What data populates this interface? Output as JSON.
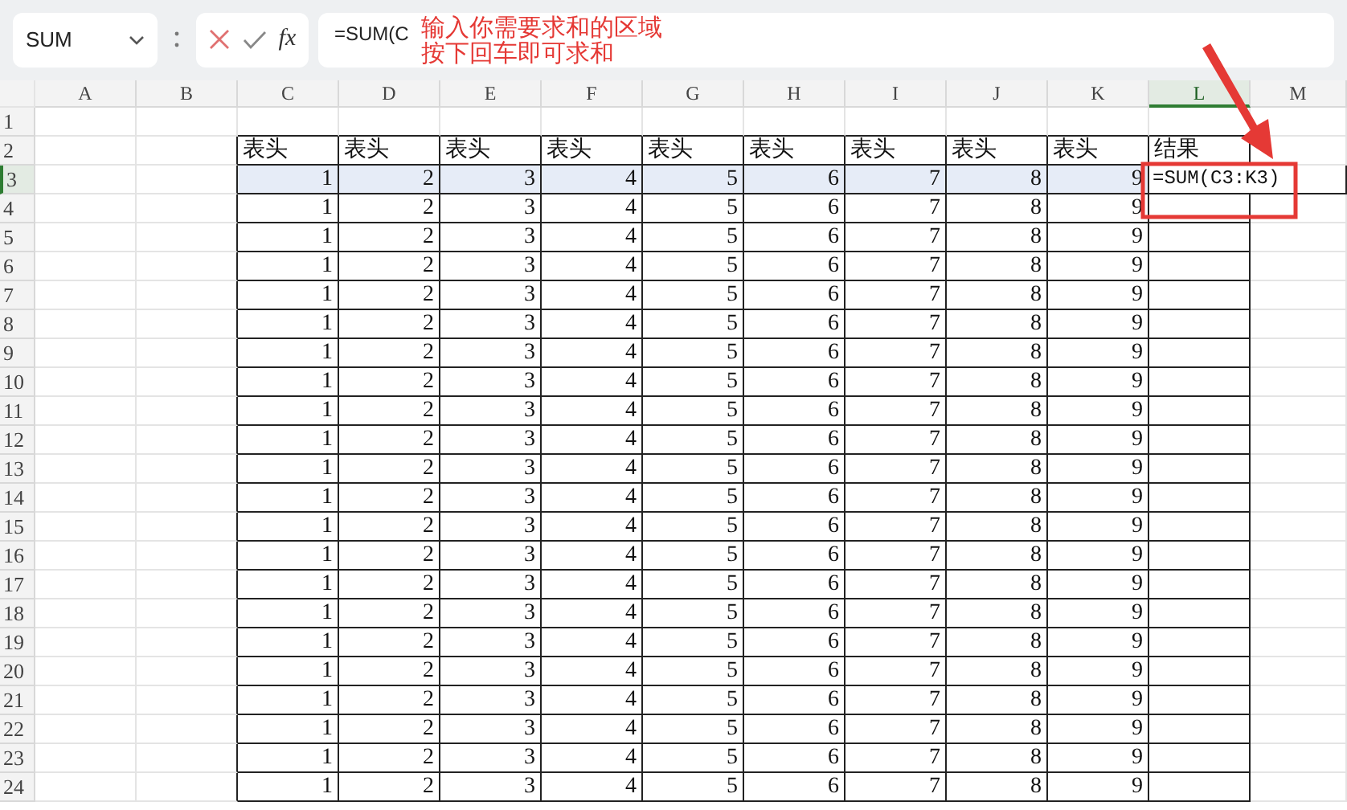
{
  "name_box": {
    "value": "SUM"
  },
  "formula_bar": {
    "function_label": "fx",
    "value": "=SUM(C"
  },
  "sheet": {
    "columns": [
      {
        "label": "A",
        "selected": false
      },
      {
        "label": "B",
        "selected": false
      },
      {
        "label": "C",
        "selected": false
      },
      {
        "label": "D",
        "selected": false
      },
      {
        "label": "E",
        "selected": false
      },
      {
        "label": "F",
        "selected": false
      },
      {
        "label": "G",
        "selected": false
      },
      {
        "label": "H",
        "selected": false
      },
      {
        "label": "I",
        "selected": false
      },
      {
        "label": "J",
        "selected": false
      },
      {
        "label": "K",
        "selected": false
      },
      {
        "label": "L",
        "selected": true
      },
      {
        "label": "M",
        "selected": false
      }
    ],
    "rows": [
      {
        "number": "1",
        "selected": false
      },
      {
        "number": "2",
        "selected": false,
        "cells": [
          "表头",
          "表头",
          "表头",
          "表头",
          "表头",
          "表头",
          "表头",
          "表头",
          "表头",
          "结果"
        ]
      },
      {
        "number": "3",
        "selected": true,
        "cells": [
          "1",
          "2",
          "3",
          "4",
          "5",
          "6",
          "7",
          "8",
          "9"
        ],
        "formula": "=SUM(C3:K3)"
      },
      {
        "number": "4",
        "selected": false,
        "cells": [
          "1",
          "2",
          "3",
          "4",
          "5",
          "6",
          "7",
          "8",
          "9"
        ]
      },
      {
        "number": "5",
        "selected": false,
        "cells": [
          "1",
          "2",
          "3",
          "4",
          "5",
          "6",
          "7",
          "8",
          "9"
        ]
      },
      {
        "number": "6",
        "selected": false,
        "cells": [
          "1",
          "2",
          "3",
          "4",
          "5",
          "6",
          "7",
          "8",
          "9"
        ]
      },
      {
        "number": "7",
        "selected": false,
        "cells": [
          "1",
          "2",
          "3",
          "4",
          "5",
          "6",
          "7",
          "8",
          "9"
        ]
      },
      {
        "number": "8",
        "selected": false,
        "cells": [
          "1",
          "2",
          "3",
          "4",
          "5",
          "6",
          "7",
          "8",
          "9"
        ]
      },
      {
        "number": "9",
        "selected": false,
        "cells": [
          "1",
          "2",
          "3",
          "4",
          "5",
          "6",
          "7",
          "8",
          "9"
        ]
      },
      {
        "number": "10",
        "selected": false,
        "cells": [
          "1",
          "2",
          "3",
          "4",
          "5",
          "6",
          "7",
          "8",
          "9"
        ]
      },
      {
        "number": "11",
        "selected": false,
        "cells": [
          "1",
          "2",
          "3",
          "4",
          "5",
          "6",
          "7",
          "8",
          "9"
        ]
      },
      {
        "number": "12",
        "selected": false,
        "cells": [
          "1",
          "2",
          "3",
          "4",
          "5",
          "6",
          "7",
          "8",
          "9"
        ]
      },
      {
        "number": "13",
        "selected": false,
        "cells": [
          "1",
          "2",
          "3",
          "4",
          "5",
          "6",
          "7",
          "8",
          "9"
        ]
      },
      {
        "number": "14",
        "selected": false,
        "cells": [
          "1",
          "2",
          "3",
          "4",
          "5",
          "6",
          "7",
          "8",
          "9"
        ]
      },
      {
        "number": "15",
        "selected": false,
        "cells": [
          "1",
          "2",
          "3",
          "4",
          "5",
          "6",
          "7",
          "8",
          "9"
        ]
      },
      {
        "number": "16",
        "selected": false,
        "cells": [
          "1",
          "2",
          "3",
          "4",
          "5",
          "6",
          "7",
          "8",
          "9"
        ]
      },
      {
        "number": "17",
        "selected": false,
        "cells": [
          "1",
          "2",
          "3",
          "4",
          "5",
          "6",
          "7",
          "8",
          "9"
        ]
      },
      {
        "number": "18",
        "selected": false,
        "cells": [
          "1",
          "2",
          "3",
          "4",
          "5",
          "6",
          "7",
          "8",
          "9"
        ]
      },
      {
        "number": "19",
        "selected": false,
        "cells": [
          "1",
          "2",
          "3",
          "4",
          "5",
          "6",
          "7",
          "8",
          "9"
        ]
      },
      {
        "number": "20",
        "selected": false,
        "cells": [
          "1",
          "2",
          "3",
          "4",
          "5",
          "6",
          "7",
          "8",
          "9"
        ]
      },
      {
        "number": "21",
        "selected": false,
        "cells": [
          "1",
          "2",
          "3",
          "4",
          "5",
          "6",
          "7",
          "8",
          "9"
        ]
      },
      {
        "number": "22",
        "selected": false,
        "cells": [
          "1",
          "2",
          "3",
          "4",
          "5",
          "6",
          "7",
          "8",
          "9"
        ]
      },
      {
        "number": "23",
        "selected": false,
        "cells": [
          "1",
          "2",
          "3",
          "4",
          "5",
          "6",
          "7",
          "8",
          "9"
        ]
      },
      {
        "number": "24",
        "selected": false,
        "cells": [
          "1",
          "2",
          "3",
          "4",
          "5",
          "6",
          "7",
          "8",
          "9"
        ]
      }
    ]
  },
  "annotation": {
    "lines": [
      "输入你需要求和的区域",
      "按下回车即可求和"
    ]
  }
}
